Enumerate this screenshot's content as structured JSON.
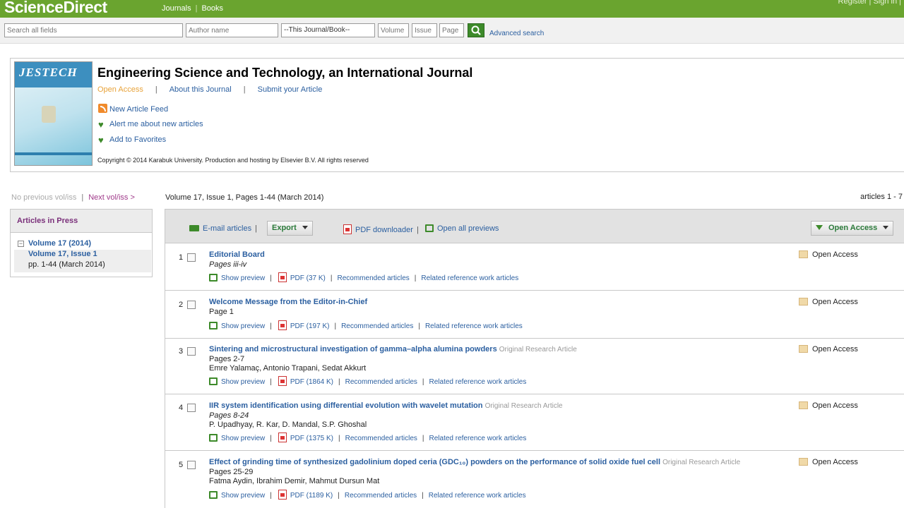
{
  "header": {
    "logo": "ScienceDirect",
    "nav": [
      "Journals",
      "Books"
    ],
    "right_text": "Register   |   Sign in   |"
  },
  "search": {
    "all_fields_placeholder": "Search all fields",
    "author_placeholder": "Author name",
    "journal_select": "--This Journal/Book--",
    "volume_placeholder": "Volume",
    "issue_placeholder": "Issue",
    "page_placeholder": "Page",
    "advanced_label": "Advanced search"
  },
  "journal": {
    "cover_title": "JESTECH",
    "title": "Engineering Science and Technology, an International Journal",
    "links": {
      "open_access": "Open Access",
      "about": "About this Journal",
      "submit": "Submit your Article"
    },
    "actions": {
      "feed": "New Article Feed",
      "alert": "Alert me about new articles",
      "favorites": "Add to Favorites"
    },
    "copyright": "Copyright © 2014 Karabuk University. Production and hosting by Elsevier B.V. All rights reserved"
  },
  "sidebar": {
    "prev": "No previous vol/iss",
    "next": "Next vol/iss >",
    "articles_in_press": "Articles in Press",
    "volume_2014": "Volume 17 (2014)",
    "issue": "Volume 17, Issue 1",
    "issue_pages": "pp. 1-44 (March 2014)"
  },
  "main": {
    "volume_info": "Volume 17, Issue 1, Pages 1-44 (March 2014)",
    "article_count": "articles 1 - 7",
    "toolbar": {
      "email": "E-mail articles",
      "export": "Export",
      "pdf_downloader": "PDF downloader",
      "open_previews": "Open all previews",
      "open_access_filter": "Open Access"
    }
  },
  "articles": [
    {
      "num": "1",
      "title": "Editorial Board",
      "type": "",
      "pages": "Pages iii-iv",
      "authors": "",
      "show_preview": "Show preview",
      "pdf": "PDF (37 K)",
      "recommended": "Recommended articles",
      "related": "Related reference work articles",
      "access": "Open Access"
    },
    {
      "num": "2",
      "title": "Welcome Message from the Editor-in-Chief",
      "type": "",
      "pages": "Page 1",
      "authors": "",
      "show_preview": "Show preview",
      "pdf": "PDF (197 K)",
      "recommended": "Recommended articles",
      "related": "Related reference work articles",
      "access": "Open Access"
    },
    {
      "num": "3",
      "title": "Sintering and microstructural investigation of gamma–alpha alumina powders",
      "type": "Original Research Article",
      "pages": "Pages 2-7",
      "authors": "Emre Yalamaç, Antonio Trapani, Sedat Akkurt",
      "show_preview": "Show preview",
      "pdf": "PDF (1864 K)",
      "recommended": "Recommended articles",
      "related": "Related reference work articles",
      "access": "Open Access"
    },
    {
      "num": "4",
      "title": "IIR system identification using differential evolution with wavelet mutation",
      "type": "Original Research Article",
      "pages": "Pages 8-24",
      "authors": "P. Upadhyay, R. Kar, D. Mandal, S.P. Ghoshal",
      "show_preview": "Show preview",
      "pdf": "PDF (1375 K)",
      "recommended": "Recommended articles",
      "related": "Related reference work articles",
      "access": "Open Access"
    },
    {
      "num": "5",
      "title": "Effect of grinding time of synthesized gadolinium doped ceria (GDC₁₀) powders on the performance of solid oxide fuel cell",
      "type": "Original Research Article",
      "pages": "Pages 25-29",
      "authors": "Fatma Aydin, Ibrahim Demir, Mahmut Dursun Mat",
      "show_preview": "Show preview",
      "pdf": "PDF (1189 K)",
      "recommended": "Recommended articles",
      "related": "Related reference work articles",
      "access": "Open Access"
    }
  ],
  "colors": {
    "brand_green": "#6aa42f",
    "link_blue": "#2b5fa0",
    "open_access_orange": "#e8a33a"
  }
}
